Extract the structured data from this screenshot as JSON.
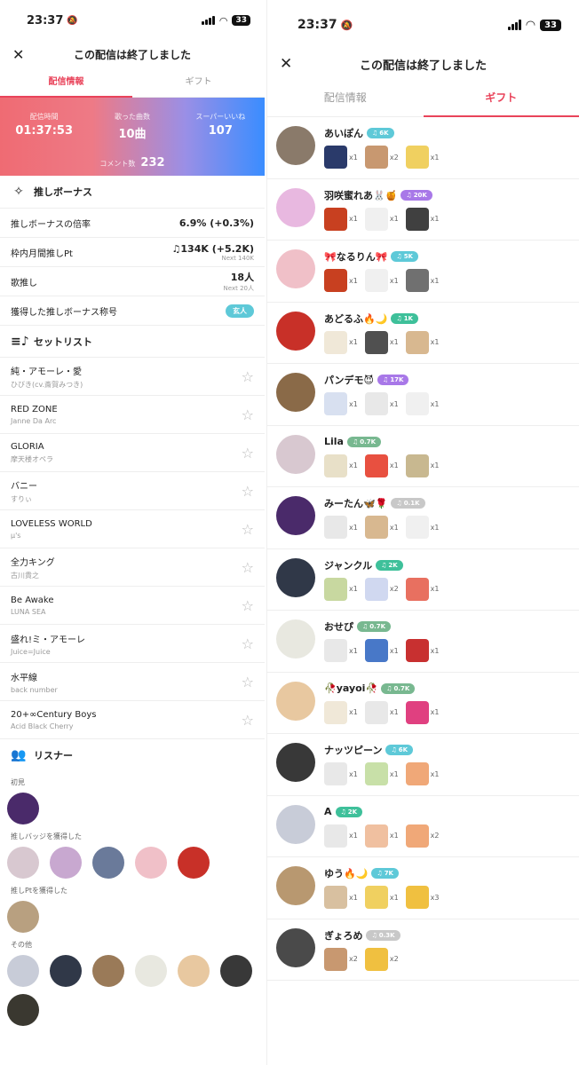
{
  "status": {
    "time": "23:37",
    "battery": "33"
  },
  "header": {
    "title": "この配信は終了しました"
  },
  "tabs": [
    "配信情報",
    "ギフト"
  ],
  "stats": {
    "duration_label": "配信時間",
    "duration": "01:37:53",
    "songs_label": "歌った曲数",
    "songs": "10曲",
    "likes_label": "スーパーいいね",
    "likes": "107",
    "comments_label": "コメント数",
    "comments": "232"
  },
  "bonus": {
    "heading": "推しボーナス",
    "rows": [
      {
        "label": "推しボーナスの倍率",
        "value": "6.9% (+0.3%)",
        "sub": ""
      },
      {
        "label": "枠内月間推しPt",
        "value": "♫134K (+5.2K)",
        "sub": "Next 140K"
      },
      {
        "label": "歌推し",
        "value": "18人",
        "sub": "Next 20人"
      }
    ],
    "title_label": "獲得した推しボーナス称号",
    "title_tag": "玄人"
  },
  "setlist": {
    "heading": "セットリスト",
    "songs": [
      {
        "title": "純・アモーレ・愛",
        "artist": "ひびき(cv.斎賀みつき)"
      },
      {
        "title": "RED ZONE",
        "artist": "Janne Da Arc"
      },
      {
        "title": "GLORIA",
        "artist": "摩天楼オペラ"
      },
      {
        "title": "バニー",
        "artist": "すりぃ"
      },
      {
        "title": "LOVELESS WORLD",
        "artist": "μ's"
      },
      {
        "title": "全力キング",
        "artist": "古川貴之"
      },
      {
        "title": "Be Awake",
        "artist": "LUNA SEA"
      },
      {
        "title": "盛れ!ミ・アモーレ",
        "artist": "Juice=Juice"
      },
      {
        "title": "水平線",
        "artist": "back number"
      },
      {
        "title": "20+∞Century Boys",
        "artist": "Acid Black Cherry"
      }
    ]
  },
  "listeners": {
    "heading": "リスナー",
    "groups": [
      {
        "label": "初見",
        "colors": [
          "#4a2a6a"
        ]
      },
      {
        "label": "推しバッジを獲得した",
        "colors": [
          "#d8c8d0",
          "#c8a8d0",
          "#6a7a9a",
          "#f0c0c8",
          "#c83028"
        ]
      },
      {
        "label": "推しPtを獲得した",
        "colors": [
          "#b8a080"
        ]
      },
      {
        "label": "その他",
        "colors": [
          "#c8ccd8",
          "#303848",
          "#9a7a58",
          "#e8e8e0",
          "#e8c8a0",
          "#383838",
          "#3a3830"
        ]
      }
    ]
  },
  "gifters": [
    {
      "name": "あいぽん",
      "pill": "6K",
      "pill_color": "#5ec9d8",
      "avatar": "#8a7a6a",
      "gifts": [
        {
          "c": "#2a3a6a",
          "n": "x1"
        },
        {
          "c": "#c89870",
          "n": "x2"
        },
        {
          "c": "#f0d060",
          "n": "x1"
        }
      ]
    },
    {
      "name": "羽咲蜜れあ🐰🍯",
      "pill": "20K",
      "pill_color": "#a878e8",
      "avatar": "#e8b8e0",
      "gifts": [
        {
          "c": "#c84020",
          "n": "x1"
        },
        {
          "c": "#f0f0f0",
          "n": "x1"
        },
        {
          "c": "#404040",
          "n": "x1"
        }
      ]
    },
    {
      "name": "🎀なるりん🎀",
      "pill": "5K",
      "pill_color": "#5ec9d8",
      "avatar": "#f0c0c8",
      "gifts": [
        {
          "c": "#c84020",
          "n": "x1"
        },
        {
          "c": "#f0f0f0",
          "n": "x1"
        },
        {
          "c": "#707070",
          "n": "x1"
        }
      ]
    },
    {
      "name": "あどるふ🔥🌙",
      "pill": "1K",
      "pill_color": "#3ec09a",
      "avatar": "#c83028",
      "gifts": [
        {
          "c": "#f0e8d8",
          "n": "x1"
        },
        {
          "c": "#505050",
          "n": "x1"
        },
        {
          "c": "#d8b890",
          "n": "x1"
        }
      ]
    },
    {
      "name": "パンデモ😈",
      "pill": "17K",
      "pill_color": "#a878e8",
      "avatar": "#8a6a48",
      "gifts": [
        {
          "c": "#d8e0f0",
          "n": "x1"
        },
        {
          "c": "#e8e8e8",
          "n": "x1"
        },
        {
          "c": "#f0f0f0",
          "n": "x1"
        }
      ]
    },
    {
      "name": "Lila",
      "pill": "0.7K",
      "pill_color": "#78b890",
      "avatar": "#d8c8d0",
      "gifts": [
        {
          "c": "#e8e0c8",
          "n": "x1"
        },
        {
          "c": "#e85040",
          "n": "x1"
        },
        {
          "c": "#c8b890",
          "n": "x1"
        }
      ]
    },
    {
      "name": "みーたん🦋🌹",
      "pill": "0.1K",
      "pill_color": "#c8c8c8",
      "avatar": "#4a2a6a",
      "gifts": [
        {
          "c": "#e8e8e8",
          "n": "x1"
        },
        {
          "c": "#d8b890",
          "n": "x1"
        },
        {
          "c": "#f0f0f0",
          "n": "x1"
        }
      ]
    },
    {
      "name": "ジャンクル",
      "pill": "2K",
      "pill_color": "#3ec09a",
      "avatar": "#303848",
      "gifts": [
        {
          "c": "#c8d8a0",
          "n": "x1"
        },
        {
          "c": "#d0d8f0",
          "n": "x2"
        },
        {
          "c": "#e87060",
          "n": "x1"
        }
      ]
    },
    {
      "name": "おせぴ",
      "pill": "0.7K",
      "pill_color": "#78b890",
      "avatar": "#e8e8e0",
      "gifts": [
        {
          "c": "#e8e8e8",
          "n": "x1"
        },
        {
          "c": "#4878c8",
          "n": "x1"
        },
        {
          "c": "#c83030",
          "n": "x1"
        }
      ]
    },
    {
      "name": "🥀yayoi🥀",
      "pill": "0.7K",
      "pill_color": "#78b890",
      "avatar": "#e8c8a0",
      "gifts": [
        {
          "c": "#f0e8d8",
          "n": "x1"
        },
        {
          "c": "#e8e8e8",
          "n": "x1"
        },
        {
          "c": "#e04080",
          "n": "x1"
        }
      ]
    },
    {
      "name": "ナッツピーン",
      "pill": "6K",
      "pill_color": "#5ec9d8",
      "avatar": "#383838",
      "gifts": [
        {
          "c": "#e8e8e8",
          "n": "x1"
        },
        {
          "c": "#c8e0a8",
          "n": "x1"
        },
        {
          "c": "#f0a878",
          "n": "x1"
        }
      ]
    },
    {
      "name": "A",
      "pill": "2K",
      "pill_color": "#3ec09a",
      "avatar": "#c8ccd8",
      "gifts": [
        {
          "c": "#e8e8e8",
          "n": "x1"
        },
        {
          "c": "#f0c0a0",
          "n": "x1"
        },
        {
          "c": "#f0a878",
          "n": "x2"
        }
      ]
    },
    {
      "name": "ゆう🔥🌙",
      "pill": "7K",
      "pill_color": "#5ec9d8",
      "avatar": "#b89870",
      "gifts": [
        {
          "c": "#d8c0a0",
          "n": "x1"
        },
        {
          "c": "#f0d060",
          "n": "x1"
        },
        {
          "c": "#f0c040",
          "n": "x3"
        }
      ]
    },
    {
      "name": "ぎょろめ",
      "pill": "0.3K",
      "pill_color": "#c8c8c8",
      "avatar": "#4a4a4a",
      "gifts": [
        {
          "c": "#c89870",
          "n": "x2"
        },
        {
          "c": "#f0c040",
          "n": "x2"
        }
      ]
    }
  ]
}
